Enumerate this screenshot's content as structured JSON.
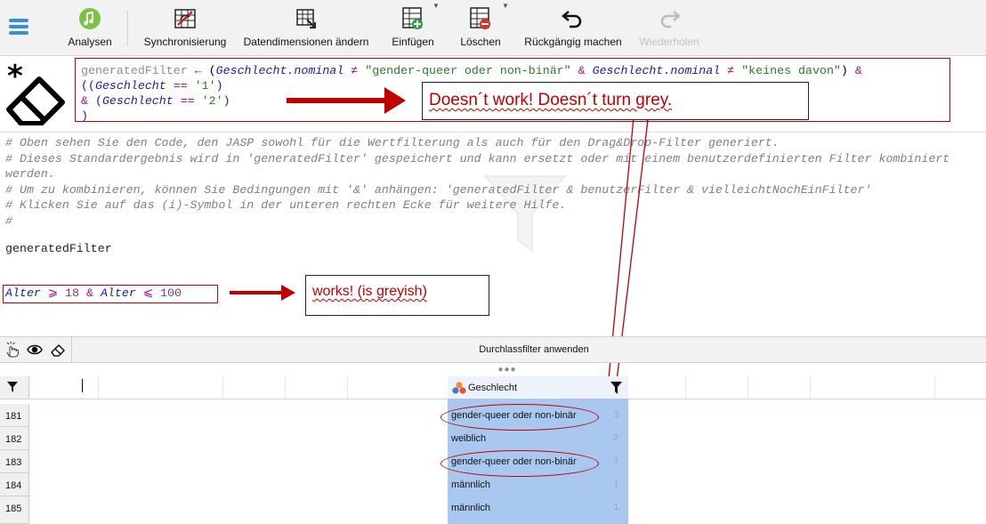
{
  "toolbar": {
    "analysen": "Analysen",
    "sync": "Synchronisierung",
    "dims": "Datendimensionen ändern",
    "insert": "Einfügen",
    "delete": "Löschen",
    "undo": "Rückgängig machen",
    "redo": "Wiederholen",
    "accent": "#3b8dd6"
  },
  "editor": {
    "line1_prefix": "generatedFilter",
    "line1_arrow": "←",
    "line1_var1": "Geschlecht.nominal",
    "line1_neq": "≠",
    "line1_str1": "\"gender-queer oder non-binär\"",
    "line1_amp": "&",
    "line1_var2": "Geschlecht.nominal",
    "line1_str2": "\"keines davon\"",
    "line2_var": "Geschlecht",
    "line2_eq": "==",
    "line2_str": "'1'",
    "line3_var": "Geschlecht",
    "line3_str": "'2'",
    "comments": [
      "# Oben sehen Sie den Code, den JASP sowohl für die Wertfilterung als auch für den Drag&Drop-Filter generiert.",
      "# Dieses Standardergebnis wird in 'generatedFilter' gespeichert und kann ersetzt oder mit einem benutzerdefinierten Filter kombiniert",
      "werden.",
      "# Um zu kombinieren, können Sie Bedingungen mit '&' anhängen: 'generatedFilter & benutzerFilter & vielleichtNochEinFilter'",
      "# Klicken Sie auf das (i)-Symbol in der unteren rechten Ecke für weitere Hilfe.",
      "#"
    ],
    "generated_filter_line": "generatedFilter",
    "alter_var1": "Alter",
    "alter_ge": "⩾",
    "alter_val1": "18",
    "alter_amp": "&",
    "alter_var2": "Alter",
    "alter_le": "⩽",
    "alter_val2": "100"
  },
  "annotations": {
    "callout1": "Doesn´t work! Doesn´t turn grey.",
    "callout2": "works! (is greyish)",
    "annotation_color": "#c00000"
  },
  "modebar": {
    "apply": "Durchlassfilter anwenden"
  },
  "grid": {
    "column_name": "Geschlecht",
    "rows": [
      {
        "num": "181",
        "value": "gender-queer oder non-binär",
        "code": "3"
      },
      {
        "num": "182",
        "value": "weiblich",
        "code": "2"
      },
      {
        "num": "183",
        "value": "gender-queer oder non-binär",
        "code": "3"
      },
      {
        "num": "184",
        "value": "männlich",
        "code": "1"
      },
      {
        "num": "185",
        "value": "männlich",
        "code": "1"
      }
    ]
  }
}
